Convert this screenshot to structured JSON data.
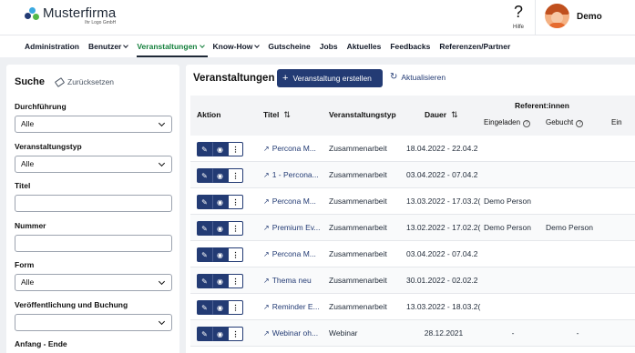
{
  "header": {
    "logo_name": "Musterfirma",
    "logo_sub": "Ihr Logo GmbH",
    "help_label": "Hilfe",
    "user_name": "Demo"
  },
  "nav": [
    {
      "label": "Administration",
      "dropdown": false,
      "active": false
    },
    {
      "label": "Benutzer",
      "dropdown": true,
      "active": false
    },
    {
      "label": "Veranstaltungen",
      "dropdown": true,
      "active": true
    },
    {
      "label": "Know-How",
      "dropdown": true,
      "active": false
    },
    {
      "label": "Gutscheine",
      "dropdown": false,
      "active": false
    },
    {
      "label": "Jobs",
      "dropdown": false,
      "active": false
    },
    {
      "label": "Aktuelles",
      "dropdown": false,
      "active": false
    },
    {
      "label": "Feedbacks",
      "dropdown": false,
      "active": false
    },
    {
      "label": "Referenzen/Partner",
      "dropdown": false,
      "active": false
    }
  ],
  "sidebar": {
    "title": "Suche",
    "reset_label": "Zurücksetzen",
    "filters": {
      "durchfuehrung": {
        "label": "Durchführung",
        "value": "Alle"
      },
      "veranstaltungstyp": {
        "label": "Veranstaltungstyp",
        "value": "Alle"
      },
      "titel": {
        "label": "Titel",
        "value": ""
      },
      "nummer": {
        "label": "Nummer",
        "value": ""
      },
      "form": {
        "label": "Form",
        "value": "Alle"
      },
      "veroeffentlichung": {
        "label": "Veröffentlichung und Buchung",
        "value": ""
      },
      "anfang_ende": {
        "label": "Anfang - Ende"
      }
    }
  },
  "main": {
    "title": "Veranstaltungen",
    "create_label": "Veranstaltung erstellen",
    "refresh_label": "Aktualisieren",
    "columns": {
      "aktion": "Aktion",
      "titel": "Titel",
      "typ": "Veranstaltungstyp",
      "dauer": "Dauer",
      "referent_group": "Referent:innen",
      "eingeladen": "Eingeladen",
      "gebucht": "Gebucht",
      "ein": "Ein"
    },
    "rows": [
      {
        "title": "Percona M...",
        "type": "Zusammenarbeit",
        "dauer": "18.04.2022 - 22.04.2",
        "eingeladen": "",
        "gebucht": ""
      },
      {
        "title": "1 - Percona...",
        "type": "Zusammenarbeit",
        "dauer": "03.04.2022 - 07.04.2",
        "eingeladen": "",
        "gebucht": ""
      },
      {
        "title": "Percona M...",
        "type": "Zusammenarbeit",
        "dauer": "13.03.2022 - 17.03.2(",
        "eingeladen": "Demo Person",
        "gebucht": ""
      },
      {
        "title": "Premium Ev...",
        "type": "Zusammenarbeit",
        "dauer": "13.02.2022 - 17.02.2(",
        "eingeladen": "Demo Person",
        "gebucht": "Demo Person"
      },
      {
        "title": "Percona M...",
        "type": "Zusammenarbeit",
        "dauer": "03.04.2022 - 07.04.2",
        "eingeladen": "",
        "gebucht": ""
      },
      {
        "title": "Thema neu",
        "type": "Zusammenarbeit",
        "dauer": "30.01.2022 - 02.02.2",
        "eingeladen": "",
        "gebucht": ""
      },
      {
        "title": "Reminder E...",
        "type": "Zusammenarbeit",
        "dauer": "13.03.2022 - 18.03.2(",
        "eingeladen": "",
        "gebucht": ""
      },
      {
        "title": "Webinar oh...",
        "type": "Webinar",
        "dauer": "28.12.2021",
        "eingeladen": "-",
        "gebucht": "-"
      }
    ]
  }
}
